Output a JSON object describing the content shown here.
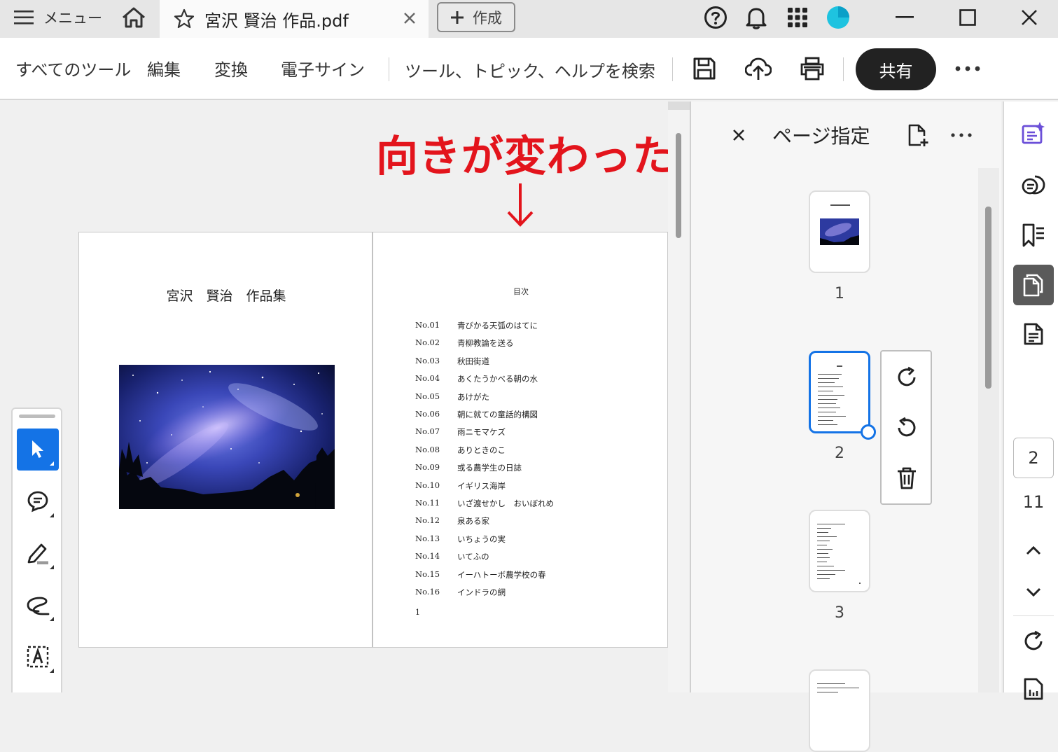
{
  "titlebar": {
    "menu_label": "メニュー",
    "doc_tab_title": "宮沢 賢治 作品.pdf",
    "create_label": "作成"
  },
  "toolbar": {
    "tabs": [
      "すべてのツール",
      "編集",
      "変換",
      "電子サイン"
    ],
    "search_label": "ツール、トピック、ヘルプを検索",
    "share_label": "共有"
  },
  "annotation": {
    "text": "向きが変わった",
    "arrow": "↓",
    "color": "#e3141c"
  },
  "pdf": {
    "title": "宮沢　賢治　作品集",
    "toc_heading": "目次",
    "toc": [
      {
        "no": "No.01",
        "title": "青びかる天弧のはてに"
      },
      {
        "no": "No.02",
        "title": "青柳教論を送る"
      },
      {
        "no": "No.03",
        "title": "秋田街道"
      },
      {
        "no": "No.04",
        "title": "あくたうかべる朝の水"
      },
      {
        "no": "No.05",
        "title": "あけがた"
      },
      {
        "no": "No.06",
        "title": "朝に就ての童話的構図"
      },
      {
        "no": "No.07",
        "title": "雨ニモマケズ"
      },
      {
        "no": "No.08",
        "title": "ありときのこ"
      },
      {
        "no": "No.09",
        "title": "或る農学生の日誌"
      },
      {
        "no": "No.10",
        "title": "イギリス海岸"
      },
      {
        "no": "No.11",
        "title": "いざ渡せかし　おいぼれめ"
      },
      {
        "no": "No.12",
        "title": "泉ある家"
      },
      {
        "no": "No.13",
        "title": "いちょうの実"
      },
      {
        "no": "No.14",
        "title": "いてふの"
      },
      {
        "no": "No.15",
        "title": "イーハトーボ農学校の春"
      },
      {
        "no": "No.16",
        "title": "インドラの網"
      }
    ],
    "page_number": "1"
  },
  "pane": {
    "title": "ページ指定",
    "thumbnails": [
      {
        "num": "1",
        "selected": false
      },
      {
        "num": "2",
        "selected": true
      },
      {
        "num": "3",
        "selected": false
      }
    ]
  },
  "rail": {
    "current_page": "2",
    "total_pages": "11"
  },
  "colors": {
    "accent": "#1473e6",
    "share_bg": "#222222",
    "rail_active": "#5a5a5a"
  }
}
